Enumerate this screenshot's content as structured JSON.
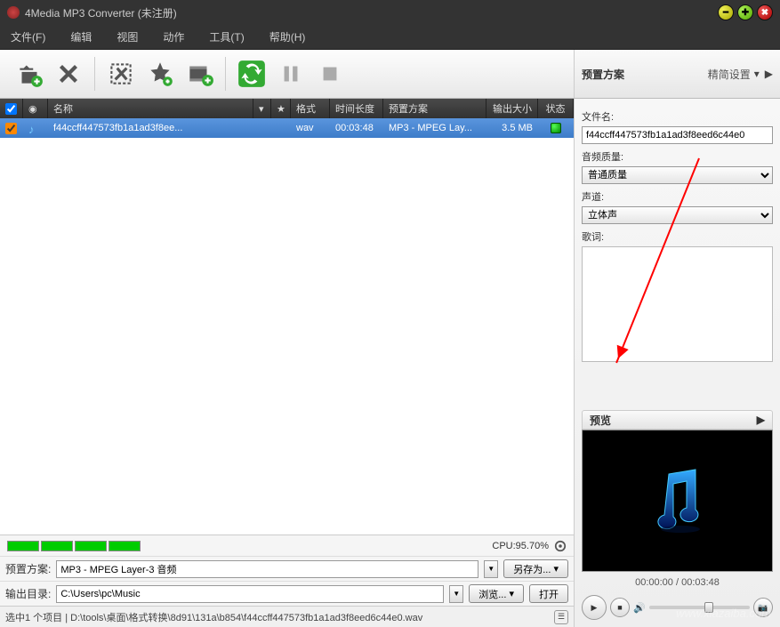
{
  "title": "4Media MP3 Converter (未注册)",
  "menu": [
    "文件(F)",
    "编辑",
    "视图",
    "动作",
    "工具(T)",
    "帮助(H)"
  ],
  "columns": {
    "name": "名称",
    "fmt": "格式",
    "dur": "时间长度",
    "preset": "预置方案",
    "size": "输出大小",
    "status": "状态"
  },
  "row": {
    "name": "f44ccff447573fb1a1ad3f8ee...",
    "fmt": "wav",
    "dur": "00:03:48",
    "preset": "MP3 - MPEG Lay...",
    "size": "3.5 MB"
  },
  "cpu": "CPU:95.70%",
  "preset_label": "预置方案:",
  "preset_value": "MP3 - MPEG Layer-3 音频",
  "saveas": "另存为...",
  "outdir_label": "输出目录:",
  "outdir_value": "C:\\Users\\pc\\Music",
  "browse": "浏览...",
  "open": "打开",
  "status_text": "选中1 个项目 | D:\\tools\\桌面\\格式转换\\8d91\\131a\\b854\\f44ccff447573fb1a1ad3f8eed6c44e0.wav",
  "side": {
    "header": "预置方案",
    "compact": "精简设置",
    "fname_lbl": "文件名:",
    "fname": "f44ccff447573fb1a1ad3f8eed6c44e0",
    "quality_lbl": "音频质量:",
    "quality": "普通质量",
    "channel_lbl": "声道:",
    "channel": "立体声",
    "lyrics_lbl": "歌词:",
    "preview": "预览",
    "time": "00:00:00 / 00:03:48"
  },
  "watermark": "www.xiazaiba.com"
}
